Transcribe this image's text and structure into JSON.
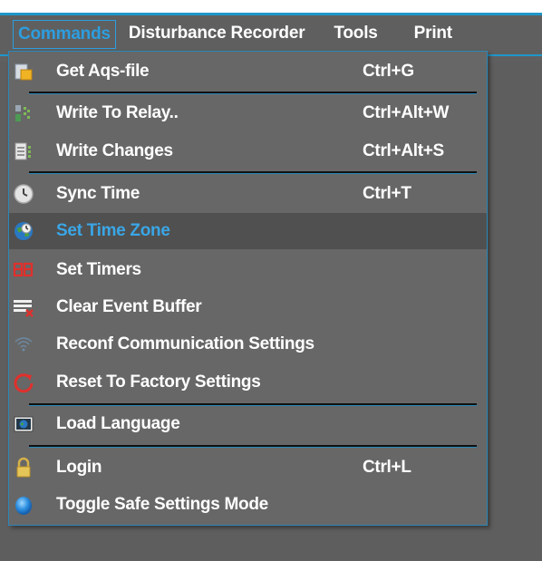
{
  "menubar": {
    "items": [
      {
        "label": "Commands"
      },
      {
        "label": "Disturbance Recorder"
      },
      {
        "label": "Tools"
      },
      {
        "label": "Print"
      }
    ]
  },
  "dropdown": {
    "items": [
      {
        "label": "Get Aqs-file",
        "shortcut": "Ctrl+G",
        "icon": "file-icon"
      },
      {
        "label": "Write To Relay..",
        "shortcut": "Ctrl+Alt+W",
        "icon": "write-relay-icon"
      },
      {
        "label": "Write Changes",
        "shortcut": "Ctrl+Alt+S",
        "icon": "write-changes-icon"
      },
      {
        "label": "Sync Time",
        "shortcut": "Ctrl+T",
        "icon": "clock-icon"
      },
      {
        "label": "Set Time Zone",
        "shortcut": "",
        "icon": "globe-clock-icon"
      },
      {
        "label": "Set Timers",
        "shortcut": "",
        "icon": "timer-digits-icon"
      },
      {
        "label": "Clear Event Buffer",
        "shortcut": "",
        "icon": "clear-buffer-icon"
      },
      {
        "label": "Reconf Communication Settings",
        "shortcut": "",
        "icon": "wifi-icon"
      },
      {
        "label": "Reset To Factory Settings",
        "shortcut": "",
        "icon": "reset-icon"
      },
      {
        "label": "Load Language",
        "shortcut": "",
        "icon": "language-icon"
      },
      {
        "label": "Login",
        "shortcut": "Ctrl+L",
        "icon": "lock-icon"
      },
      {
        "label": "Toggle Safe Settings Mode",
        "shortcut": "",
        "icon": "blue-orb-icon"
      }
    ]
  },
  "colors": {
    "accent": "#2c9ee0",
    "menu_bg": "#676767",
    "highlight_bg": "#505050",
    "text": "#ffffff"
  }
}
